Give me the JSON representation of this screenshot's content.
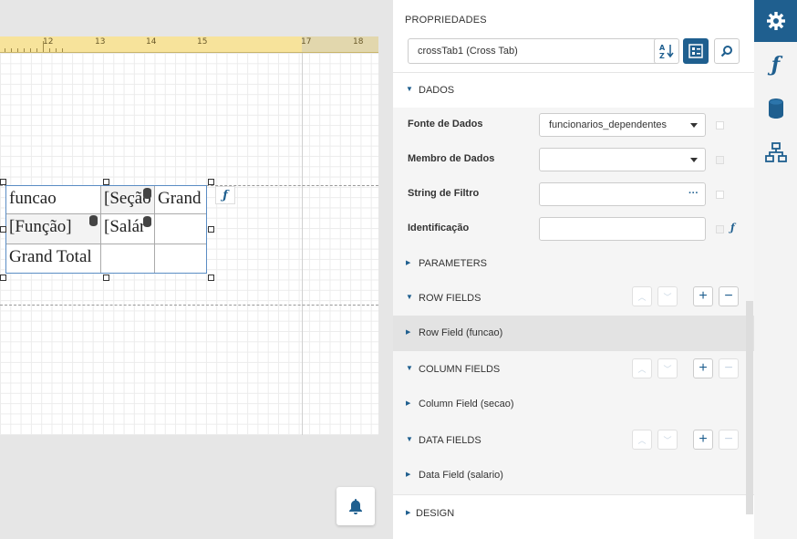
{
  "ruler": {
    "labels": [
      "12",
      "13",
      "14",
      "15",
      "17",
      "18"
    ]
  },
  "crosstab": {
    "cells": {
      "r0c0": "funcao",
      "r0c1": "[Seção",
      "r0c2": "Grand",
      "r1c0": "[Função]",
      "r1c1": "[Salár",
      "r2c0": "Grand Total"
    }
  },
  "panel": {
    "title": "PROPRIEDADES",
    "object_selector": {
      "value": "crossTab1 (Cross Tab)"
    },
    "sections": {
      "dados": "DADOS",
      "parameters": "PARAMETERS",
      "row_fields": "ROW FIELDS",
      "column_fields": "COLUMN FIELDS",
      "data_fields": "DATA FIELDS",
      "design": "DESIGN"
    },
    "properties": {
      "fonte_de_dados": {
        "label": "Fonte de Dados",
        "value": "funcionarios_dependentes"
      },
      "membro_de_dados": {
        "label": "Membro de Dados",
        "value": ""
      },
      "string_de_filtro": {
        "label": "String de Filtro",
        "value": ""
      },
      "identificacao": {
        "label": "Identificação",
        "value": ""
      }
    },
    "items": {
      "row_field": "Row Field (funcao)",
      "column_field": "Column Field (secao)",
      "data_field": "Data Field (salario)"
    }
  },
  "tabs": [
    {
      "icon": "gear-icon",
      "active": true
    },
    {
      "icon": "function-icon",
      "active": false
    },
    {
      "icon": "database-icon",
      "active": false
    },
    {
      "icon": "hierarchy-icon",
      "active": false
    }
  ],
  "colors": {
    "accent": "#1f5f8f",
    "ruler": "#f7e39b"
  }
}
